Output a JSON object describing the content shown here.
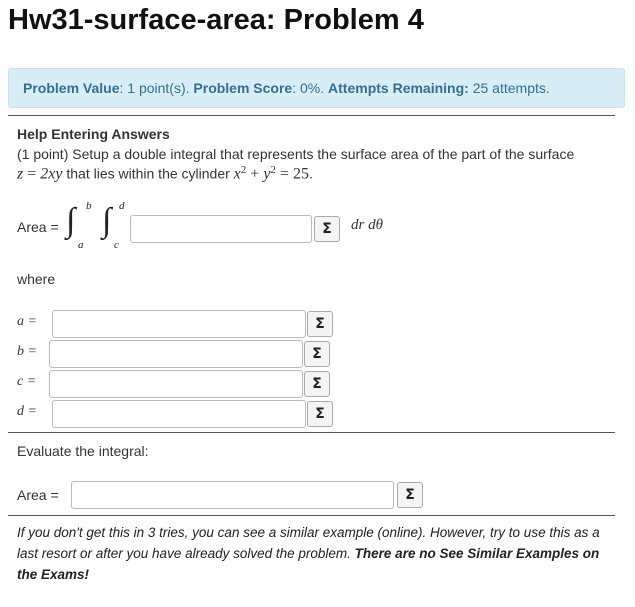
{
  "problem": {
    "title": "Hw31-surface-area: Problem 4"
  },
  "status": {
    "value_label": "Problem Value",
    "value_text": ": 1 point(s). ",
    "score_label": "Problem Score",
    "score_text": ": 0%. ",
    "attempts_label": "Attempts Remaining:",
    "attempts_text": " 25 attempts."
  },
  "help_link": "Help Entering Answers",
  "prompt": {
    "line1": "(1 point) Setup a double integral that represents the surface area of the part of the surface",
    "z": "z",
    "eq": " = ",
    "expr": "2xy",
    "middle": " that lies within the cylinder ",
    "x2": "x",
    "plus": " + ",
    "y2": "y",
    "eq2": " = ",
    "r2": "25",
    "period": "."
  },
  "area_label": "Area =",
  "integral": {
    "upper_outer": "b",
    "lower_outer": "a",
    "upper_inner": "d",
    "lower_inner": "c",
    "differential": "dr dθ"
  },
  "where_label": "where",
  "limits": [
    {
      "label": "a ="
    },
    {
      "label": "b ="
    },
    {
      "label": "c ="
    },
    {
      "label": "d ="
    }
  ],
  "evaluate_label": "Evaluate the integral:",
  "area2_label": "Area =",
  "sigma_icon": "Σ",
  "footer": {
    "text": "If you don't get this in 3 tries, you can see a similar example (online). However, try to use this as a last resort or after you have already solved the problem. ",
    "bold": "There are no See Similar Examples on the Exams!"
  }
}
